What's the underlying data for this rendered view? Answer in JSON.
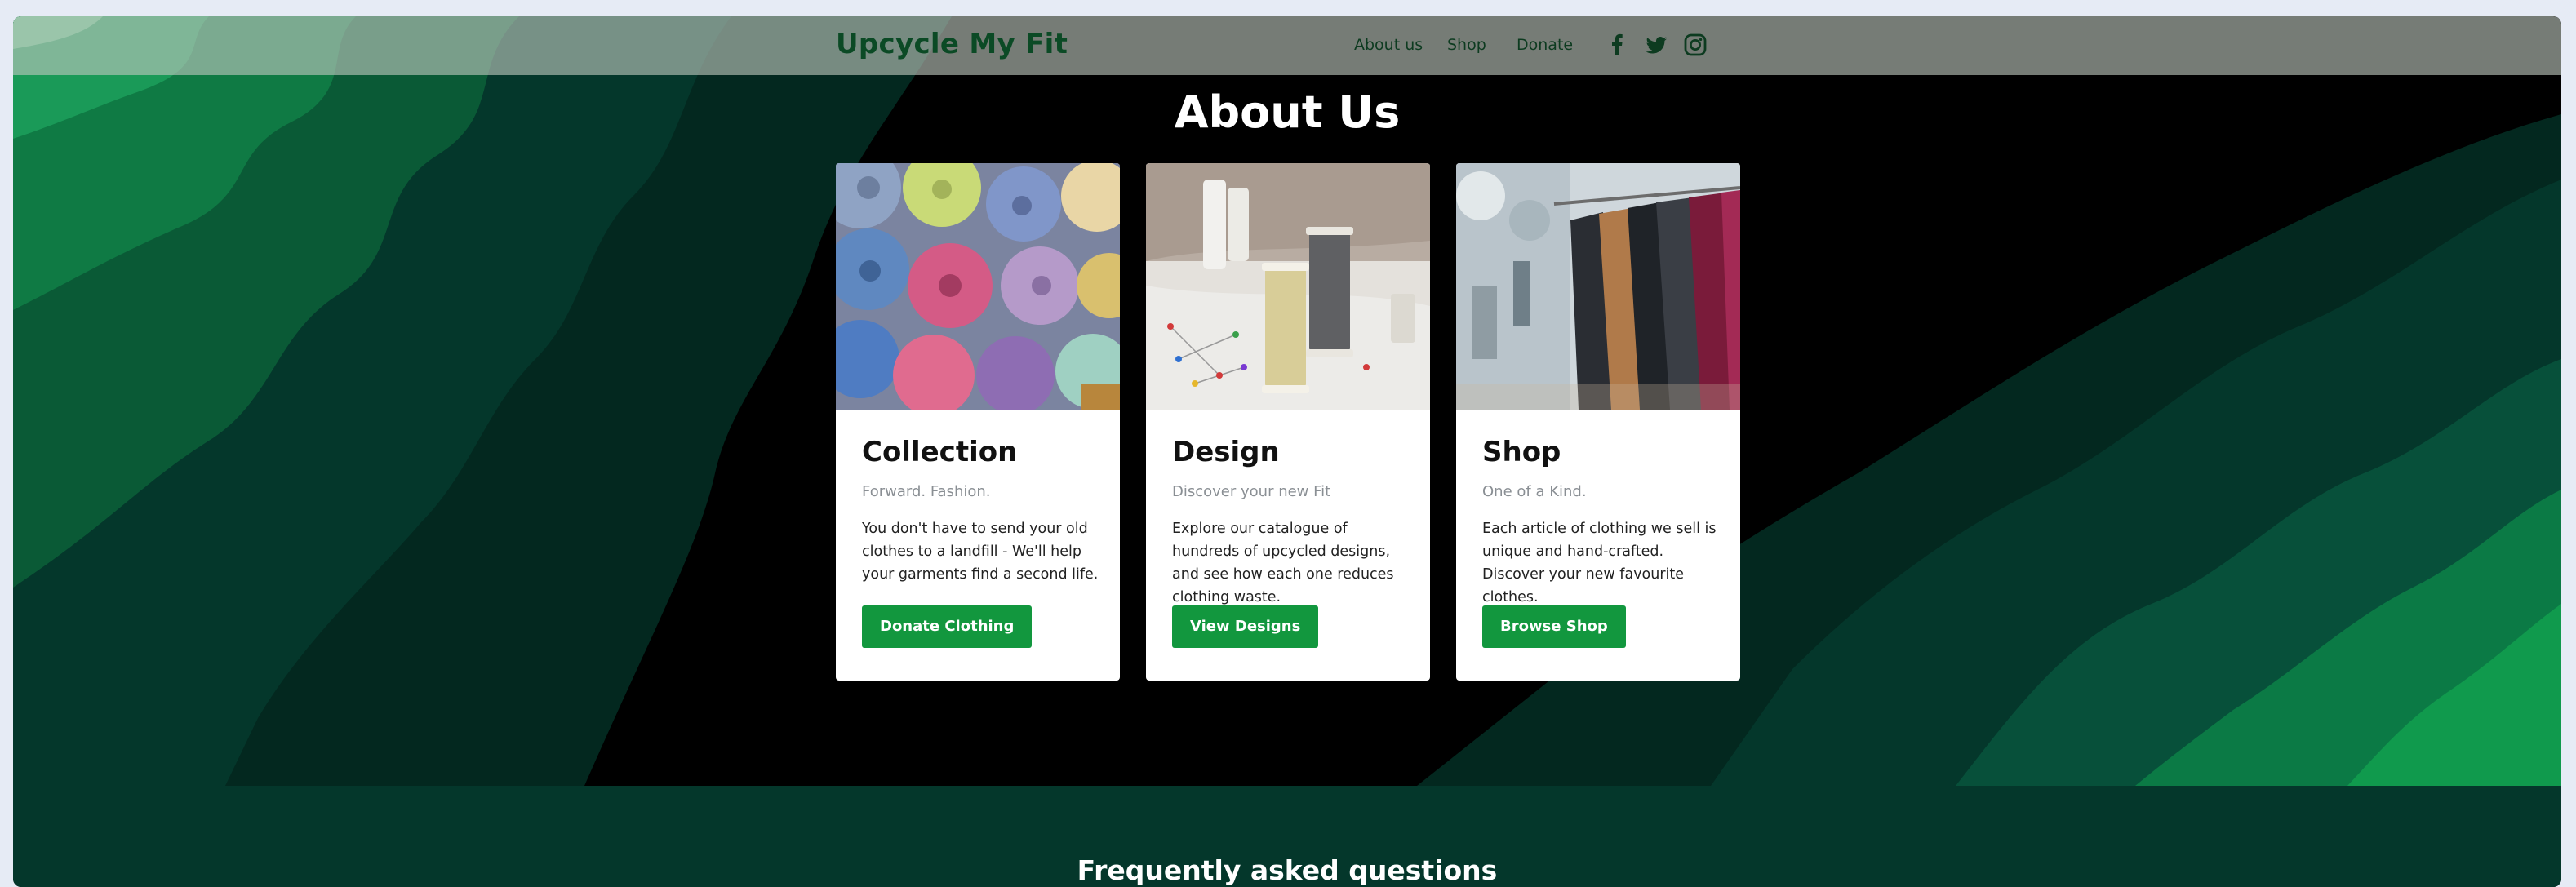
{
  "navbar": {
    "brand": "Upcycle My Fit",
    "links": [
      {
        "label": "About us"
      },
      {
        "label": "Shop"
      },
      {
        "label": "Donate"
      }
    ],
    "social_icons": [
      "facebook-icon",
      "twitter-icon",
      "instagram-icon"
    ]
  },
  "about": {
    "title": "About Us",
    "cards": [
      {
        "title": "Collection",
        "subtitle": "Forward. Fashion.",
        "text": "You don't have to send your old clothes to a landfill - We'll help your garments find a second life.",
        "button": "Donate Clothing",
        "image": "folded-fabric-rolls"
      },
      {
        "title": "Design",
        "subtitle": "Discover your new Fit",
        "text": "Explore our catalogue of hundreds of upcycled designs, and see how each one reduces clothing waste.",
        "button": "View Designs",
        "image": "thread-spools-and-pins"
      },
      {
        "title": "Shop",
        "subtitle": "One of a Kind.",
        "text": "Each article of clothing we sell is unique and hand-crafted. Discover your new favourite clothes.",
        "button": "Browse Shop",
        "image": "clothing-rack"
      }
    ]
  },
  "faq": {
    "title": "Frequently asked questions"
  },
  "colors": {
    "brand": "#0b4a25",
    "button": "#12973e",
    "faq_background": "#04372b"
  }
}
